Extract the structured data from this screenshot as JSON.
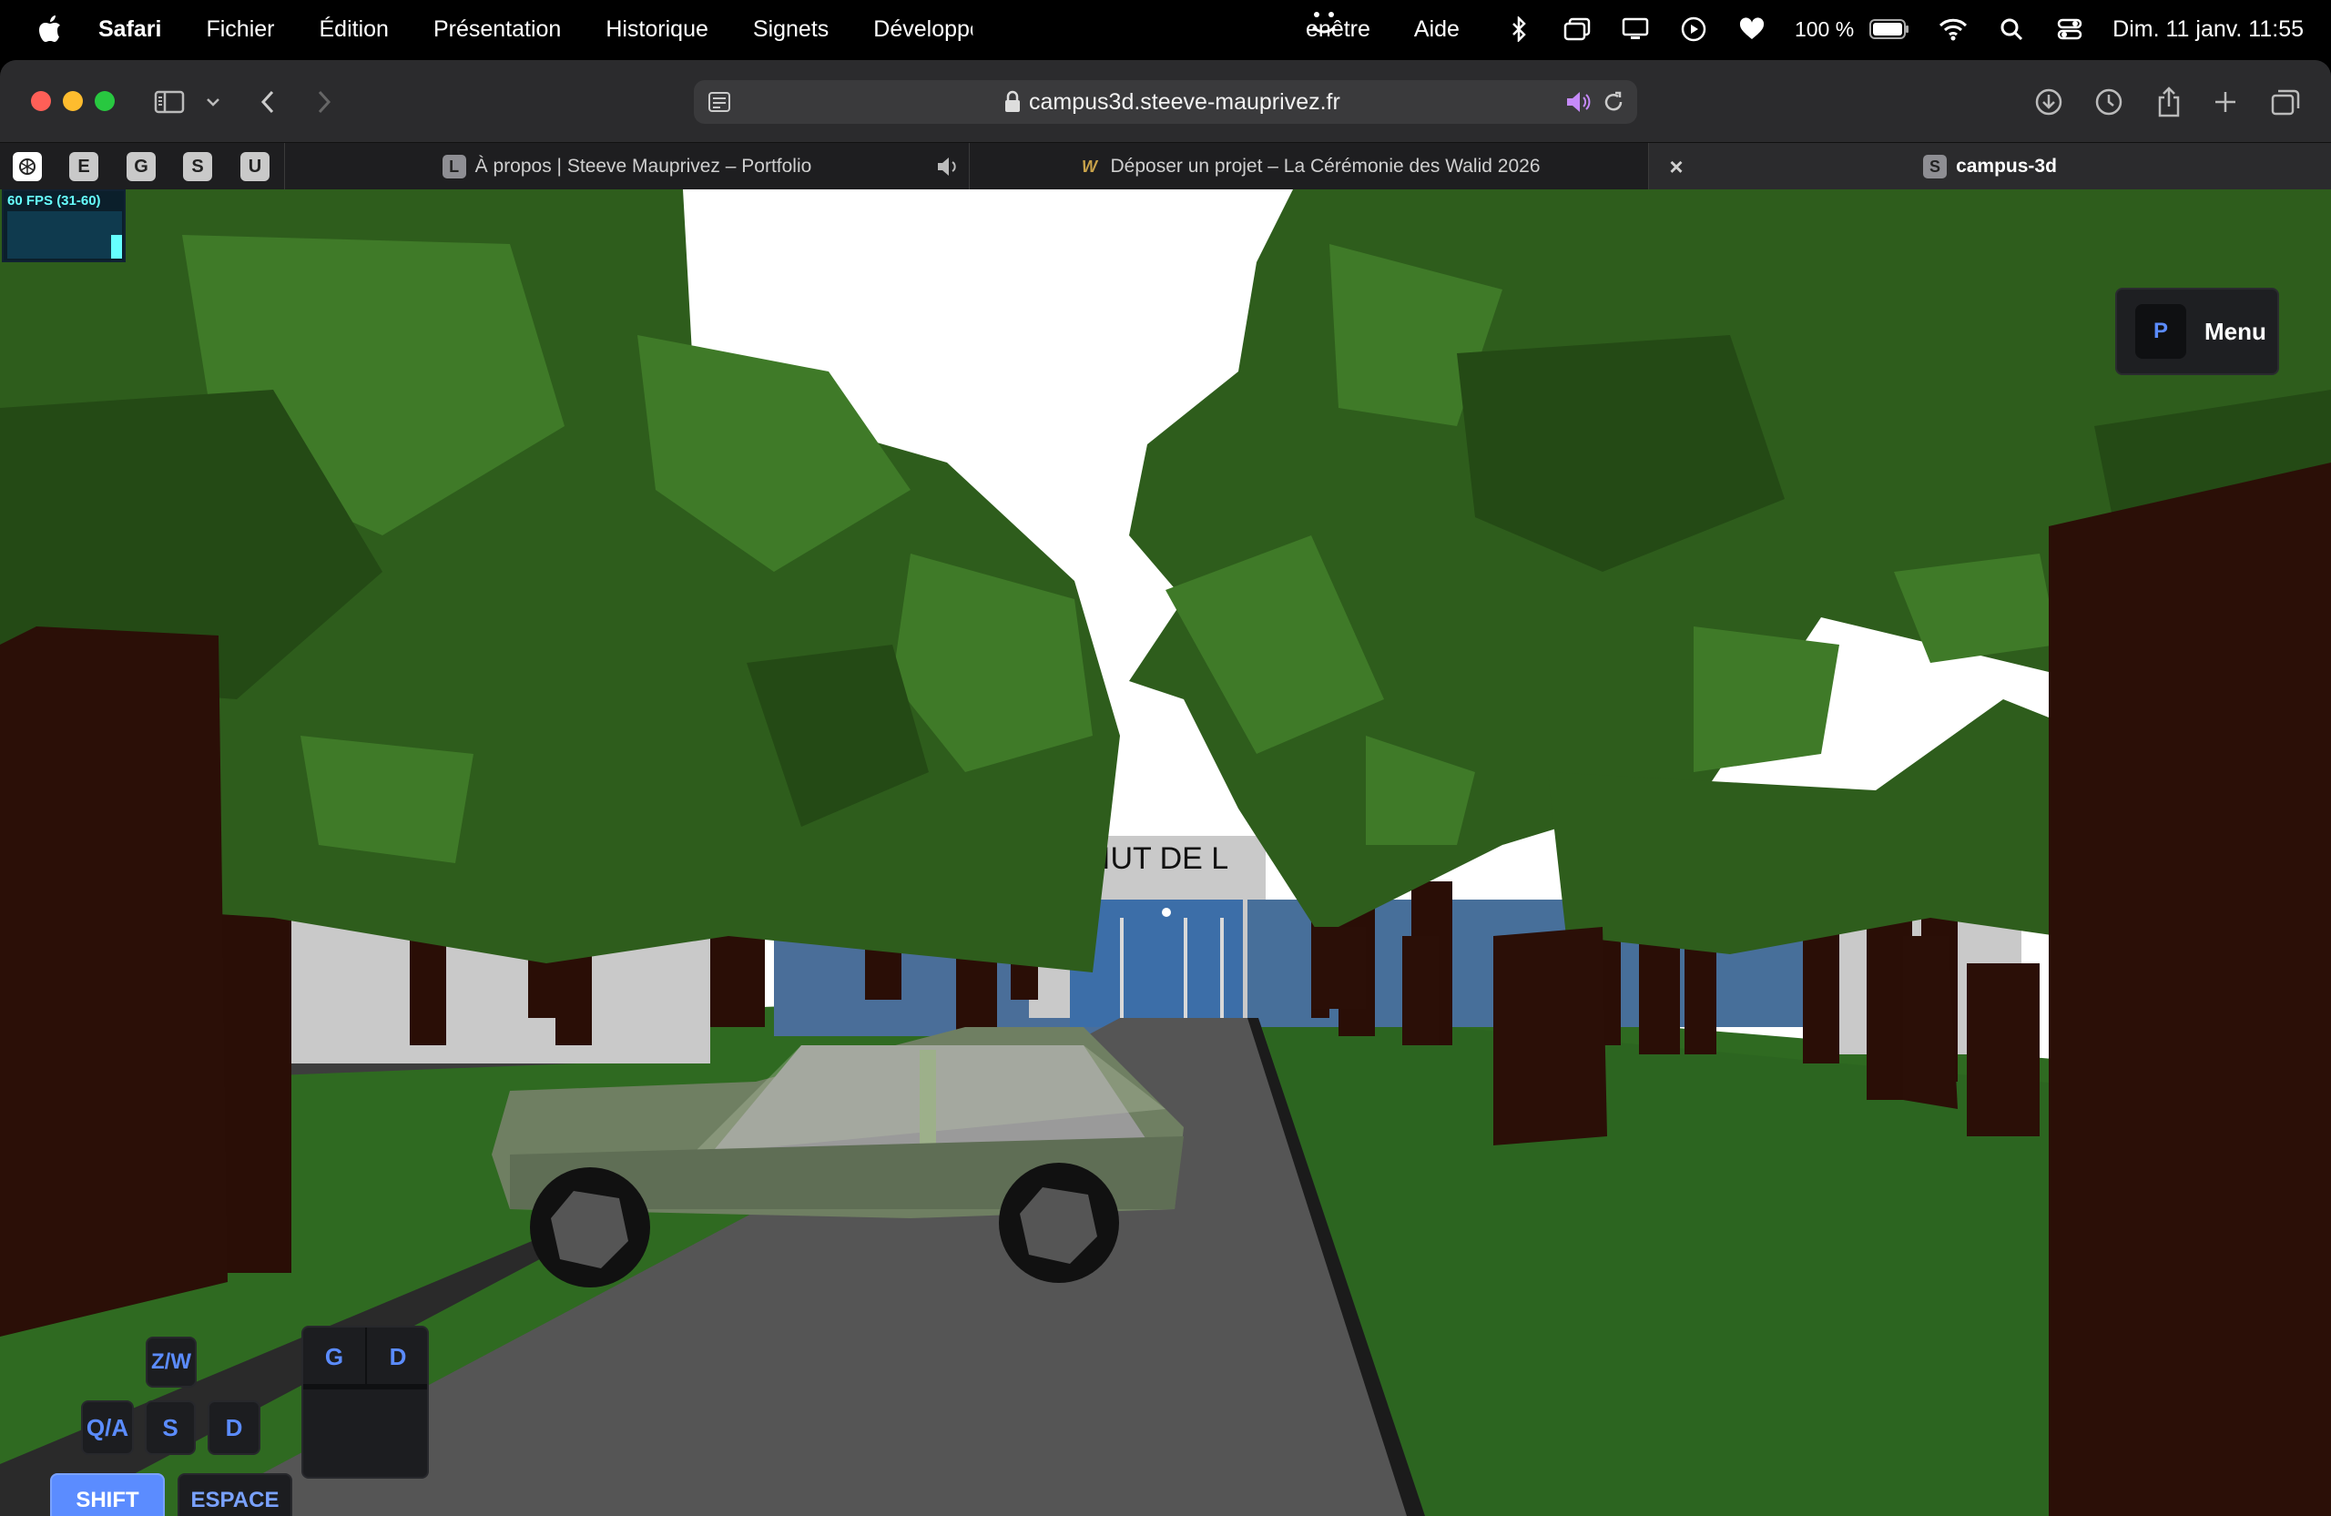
{
  "menubar": {
    "app": "Safari",
    "items": [
      "Fichier",
      "Édition",
      "Présentation",
      "Historique",
      "Signets",
      "Développeme"
    ],
    "right_items": [
      "enêtre",
      "Aide"
    ],
    "battery": "100 %",
    "clock": "Dim. 11 janv.  11:55"
  },
  "toolbar": {
    "url": "campus3d.steeve-mauprivez.fr"
  },
  "tabs": {
    "pinned": [
      "E",
      "G",
      "S",
      "U"
    ],
    "items": [
      {
        "favicon": "L",
        "title": "À propos | Steeve Mauprivez – Portfolio"
      },
      {
        "favicon": "W",
        "title": "Déposer un projet – La Cérémonie des Walid 2026"
      },
      {
        "favicon": "S",
        "title": "campus-3d"
      }
    ]
  },
  "game": {
    "fps_label": "60 FPS (31-60)",
    "building_sign": "IUT DE L",
    "menu": {
      "key": "P",
      "label": "Menu"
    },
    "controls": {
      "forward": "Z/W",
      "left": "Q/A",
      "back": "S",
      "right": "D",
      "shift": "SHIFT",
      "space": "ESPACE",
      "mouse_left": "G",
      "mouse_right": "D"
    }
  },
  "colors": {
    "accent": "#5b8cff",
    "grass": "#2f6a21",
    "road": "#555555",
    "trunk": "#2a0e06",
    "foliage": "#2e5d1c"
  }
}
